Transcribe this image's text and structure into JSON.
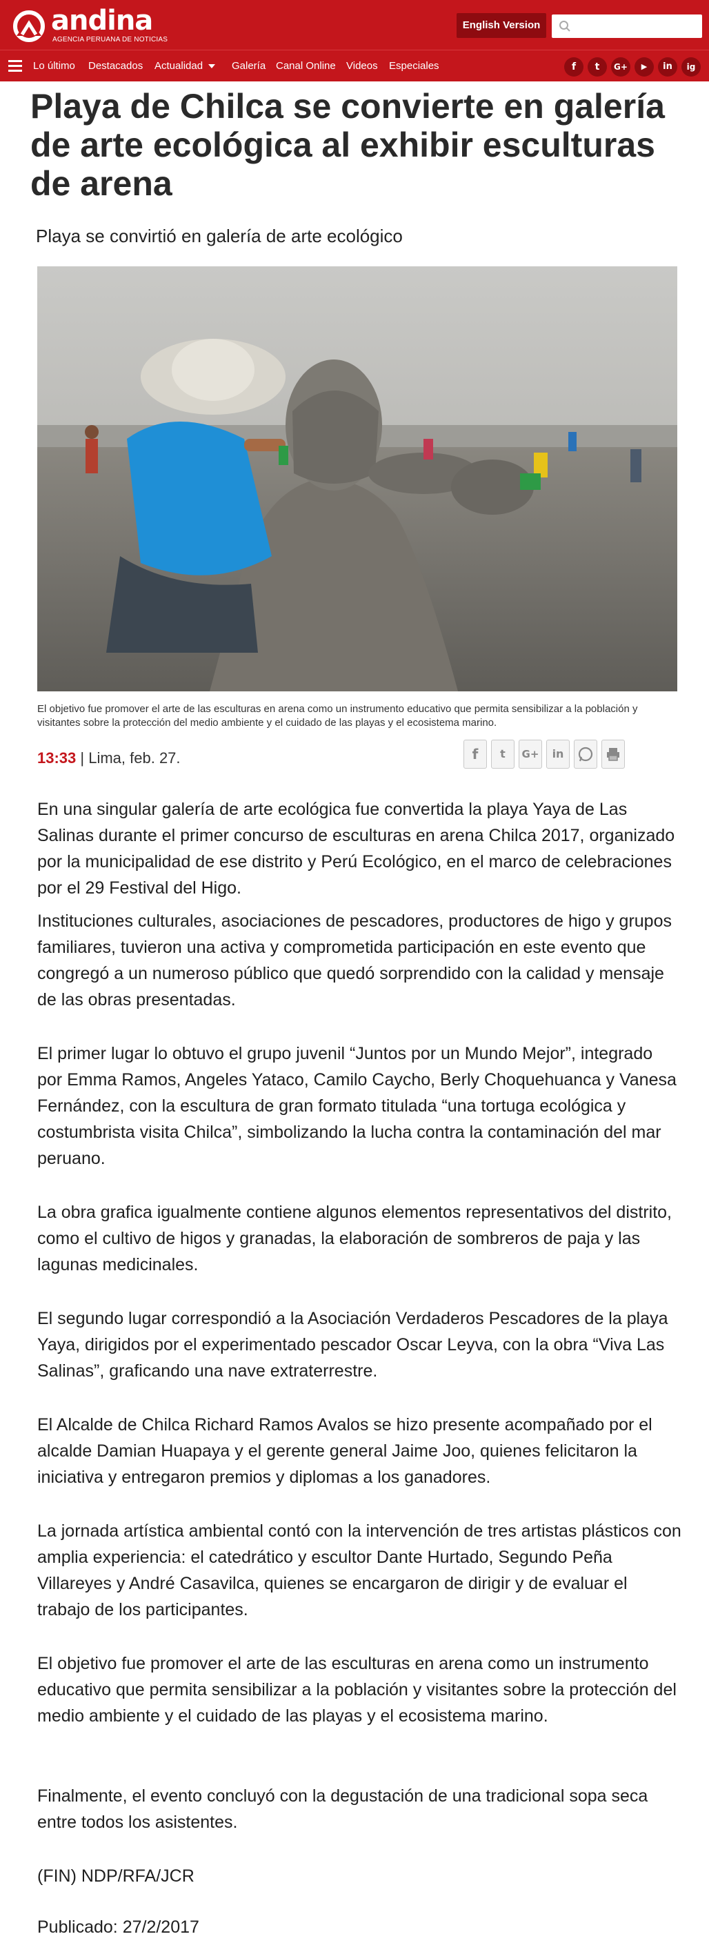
{
  "header": {
    "logo_name": "andina",
    "logo_tagline": "AGENCIA PERUANA DE NOTICIAS",
    "english_button": "English Version",
    "search_placeholder": ""
  },
  "nav": {
    "items": [
      {
        "label": "Lo último"
      },
      {
        "label": "Destacados"
      },
      {
        "label": "Actualidad"
      },
      {
        "label": "Galería"
      },
      {
        "label": "Canal Online"
      },
      {
        "label": "Videos"
      },
      {
        "label": "Especiales"
      }
    ],
    "social": [
      "f",
      "t",
      "G+",
      "▶",
      "in",
      "ig"
    ]
  },
  "colors": {
    "brand_red": "#c4161c",
    "dark_red": "#8e0b10"
  },
  "article": {
    "title": "Playa de Chilca se convierte en galería de arte ecológica al exhibir esculturas de arena",
    "subtitle": "Playa se convirtió en galería de arte ecológico",
    "caption": "El objetivo fue promover el arte de las esculturas en arena como un instrumento educativo que permita sensibilizar a la población y visitantes sobre la protección del medio ambiente y el cuidado de las playas y el ecosistema marino.",
    "time": "13:33",
    "location_date": " | Lima, feb. 27.",
    "share_icons": [
      "facebook-icon",
      "twitter-icon",
      "google-plus-icon",
      "linkedin-icon",
      "whatsapp-icon",
      "print-icon"
    ],
    "paragraphs": [
      "En una singular galería de arte ecológica fue convertida la playa Yaya de Las Salinas durante el primer concurso de esculturas en arena Chilca 2017, organizado por la municipalidad de ese distrito y Perú Ecológico, en el marco de celebraciones por el 29 Festival del Higo.",
      "Instituciones culturales, asociaciones de pescadores, productores de higo y grupos familiares, tuvieron una activa y comprometida participación en este evento que congregó a un numeroso público que quedó sorprendido con la calidad y mensaje de las obras presentadas.",
      "El primer lugar lo obtuvo el grupo juvenil “Juntos por un Mundo Mejor”, integrado por Emma Ramos, Angeles Yataco, Camilo Caycho,  Berly Choquehuanca y Vanesa Fernández, con la escultura de gran formato titulada “una tortuga ecológica y costumbrista visita Chilca”, simbolizando la lucha contra la contaminación del mar peruano.",
      "La obra grafica igualmente contiene algunos elementos representativos del distrito, como el cultivo de higos y granadas, la elaboración de sombreros de paja y las lagunas medicinales.",
      "El segundo lugar correspondió a la Asociación Verdaderos Pescadores de la playa Yaya, dirigidos por el experimentado pescador Oscar Leyva, con la obra “Viva Las Salinas”, graficando una nave extraterrestre.",
      "El Alcalde de Chilca Richard Ramos Avalos se hizo presente acompañado por el alcalde Damian Huapaya y el gerente general Jaime Joo, quienes felicitaron la iniciativa y entregaron premios y diplomas a los ganadores.",
      "La jornada artística ambiental contó con la intervención de tres artistas plásticos con amplia experiencia: el catedrático y escultor Dante Hurtado, Segundo Peña Villareyes y André Casavilca, quienes se encargaron de dirigir y de evaluar el trabajo de los participantes.",
      "El objetivo fue promover el arte de las esculturas en arena como un instrumento educativo que permita sensibilizar a la población y visitantes sobre la protección del medio ambiente y el cuidado de las playas y el ecosistema marino.",
      "Finalmente, el evento concluyó con la degustación de una tradicional sopa seca entre todos los asistentes.",
      "(FIN) NDP/RFA/JCR",
      "Publicado: 27/2/2017"
    ]
  }
}
